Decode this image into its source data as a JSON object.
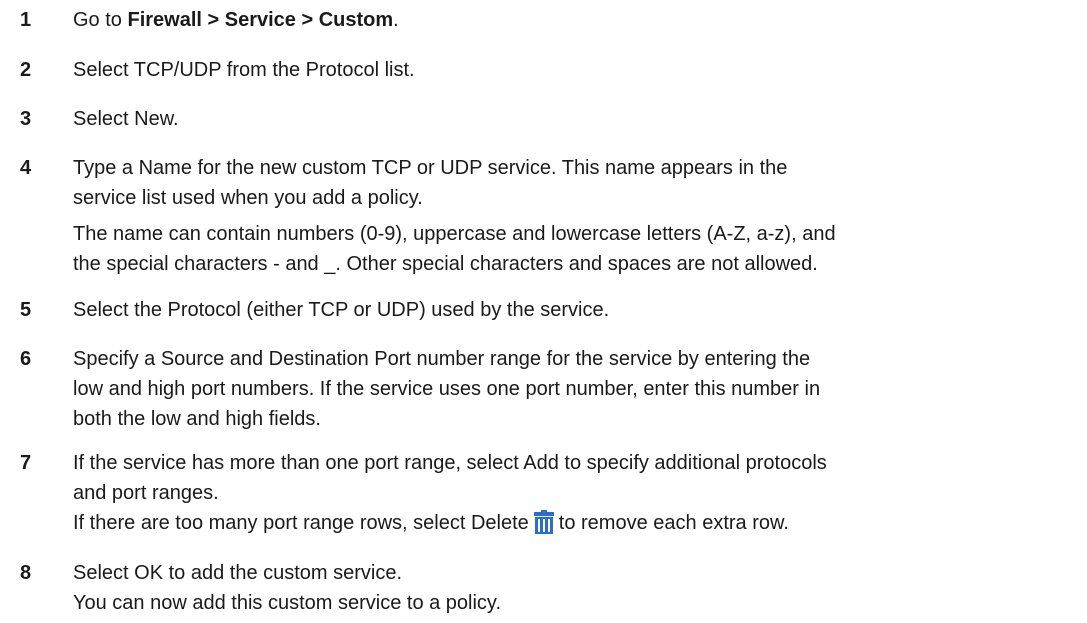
{
  "steps": [
    {
      "number": "1",
      "p1_pre": "Go to ",
      "p1_bold": "Firewall > Service > Custom",
      "p1_post": "."
    },
    {
      "number": "2",
      "p1": "Select TCP/UDP from the Protocol list."
    },
    {
      "number": "3",
      "p1": "Select New."
    },
    {
      "number": "4",
      "p1_l1": "Type a Name for the new custom TCP or UDP service. This name appears in the",
      "p1_l2": "service list used when you add a policy.",
      "p2_l1": "The name can contain numbers (0-9), uppercase and lowercase letters (A-Z, a-z), and",
      "p2_l2": "the special characters - and _. Other special characters and spaces are not allowed."
    },
    {
      "number": "5",
      "p1": "Select the Protocol (either TCP or UDP) used by the service."
    },
    {
      "number": "6",
      "p1_l1": "Specify a Source and Destination Port number range for the service by entering the",
      "p1_l2": "low and high port numbers. If the service uses one port number, enter this number in",
      "p1_l3": "both the low and high fields."
    },
    {
      "number": "7",
      "p1_l1": "If the service has more than one port range, select Add to specify additional protocols",
      "p1_l2": "and port ranges.",
      "p2_pre": "If there are too many port range rows, select Delete",
      "p2_post": "to remove each extra row.",
      "delete_icon": "trash-icon"
    },
    {
      "number": "8",
      "p1": "Select OK to add the custom service.",
      "p2": "You can now add this custom service to a policy."
    }
  ],
  "colors": {
    "text": "#1a1a1a",
    "trash_icon_blue": "#2a6fc9"
  }
}
